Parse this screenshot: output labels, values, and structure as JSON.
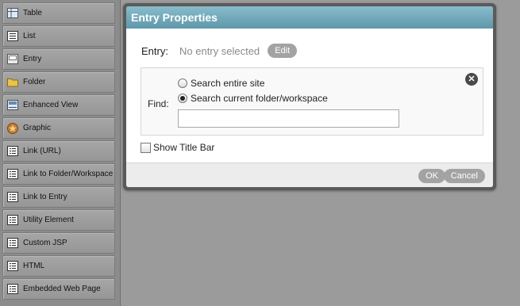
{
  "palette": {
    "items": [
      {
        "label": "Table",
        "icon": "table-icon"
      },
      {
        "label": "List",
        "icon": "list-icon"
      },
      {
        "label": "Entry",
        "icon": "entry-icon"
      },
      {
        "label": "Folder",
        "icon": "folder-icon"
      },
      {
        "label": "Enhanced View",
        "icon": "enhanced-view-icon"
      },
      {
        "label": "Graphic",
        "icon": "graphic-icon"
      },
      {
        "label": "Link (URL)",
        "icon": "link-url-icon"
      },
      {
        "label": "Link to Folder/Workspace",
        "icon": "link-folder-icon"
      },
      {
        "label": "Link to Entry",
        "icon": "link-entry-icon"
      },
      {
        "label": "Utility Element",
        "icon": "utility-element-icon"
      },
      {
        "label": "Custom JSP",
        "icon": "custom-jsp-icon"
      },
      {
        "label": "HTML",
        "icon": "html-icon"
      },
      {
        "label": "Embedded Web Page",
        "icon": "embedded-web-page-icon"
      }
    ]
  },
  "dialog": {
    "title": "Entry Properties",
    "entry_label": "Entry:",
    "entry_value": "No entry selected",
    "edit_label": "Edit",
    "find_label": "Find:",
    "radio_options": [
      {
        "label": "Search entire site",
        "checked": false
      },
      {
        "label": "Search current folder/workspace",
        "checked": true
      }
    ],
    "search_value": "",
    "close_glyph": "✕",
    "show_title_bar_label": "Show Title Bar",
    "show_title_bar_checked": false,
    "ok_label": "OK",
    "cancel_label": "Cancel"
  },
  "colors": {
    "title_bar": "#5f98aa",
    "button_pill": "#a3a3a3",
    "background": "#9b9b9b"
  }
}
